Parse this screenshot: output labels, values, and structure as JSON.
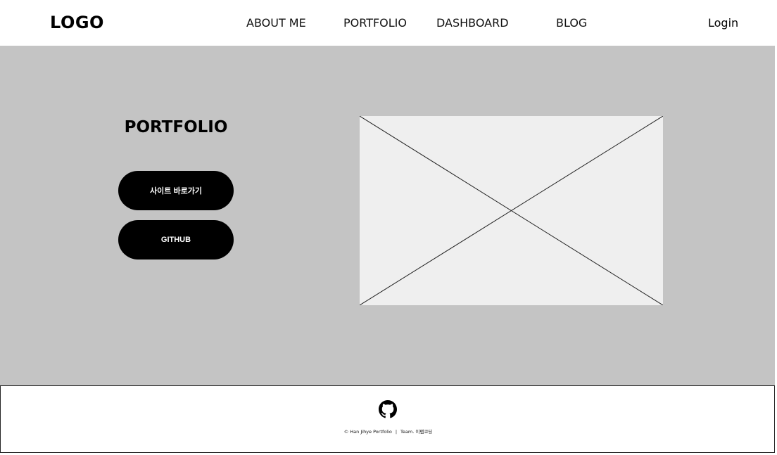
{
  "header": {
    "logo": "LOGO",
    "nav": [
      {
        "label": "ABOUT ME"
      },
      {
        "label": "PORTFOLIO"
      },
      {
        "label": "DASHBOARD"
      },
      {
        "label": "BLOG"
      }
    ],
    "login_label": "Login"
  },
  "hero": {
    "title": "PORTFOLIO",
    "buttons": [
      {
        "label": "사이트 바로가기"
      },
      {
        "label": "GITHUB"
      }
    ],
    "image_placeholder_icon": "x-cross-placeholder-icon"
  },
  "footer": {
    "icon": "github-icon",
    "copyright": "© Han Jihye Portfolio",
    "separator": "|",
    "team": "Team. 이랩코딩"
  },
  "colors": {
    "hero_bg": "#c4c4c4",
    "button_bg": "#000000",
    "button_text": "#ffffff",
    "placeholder_bg": "#efefef"
  }
}
